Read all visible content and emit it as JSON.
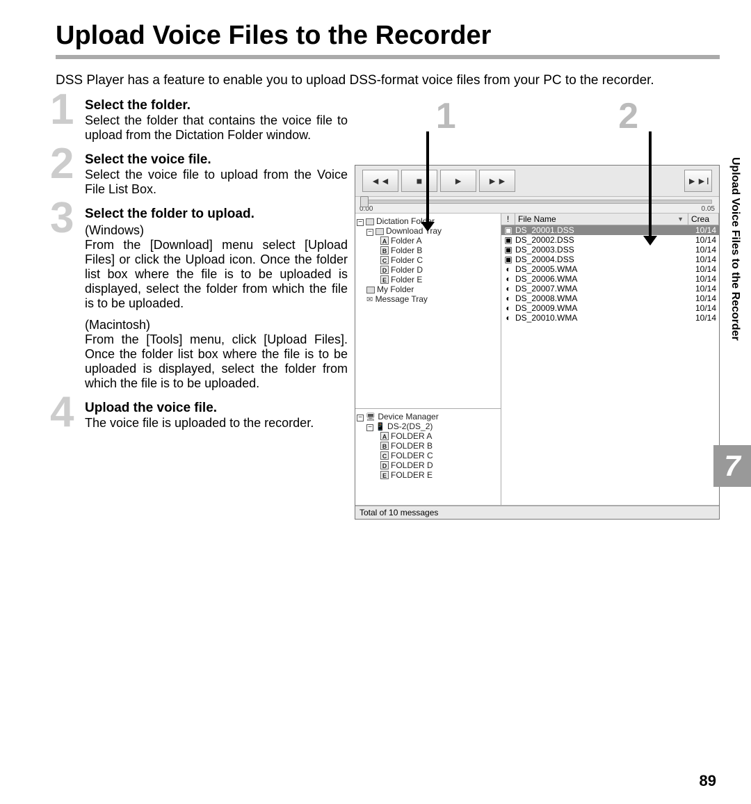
{
  "title": "Upload Voice Files to the Recorder",
  "intro": "DSS Player has a feature to enable you to upload DSS-format voice files from your PC to the recorder.",
  "steps": [
    {
      "num": "1",
      "title": "Select the folder.",
      "body": "Select the folder that contains the voice file to upload from the Dictation Folder window."
    },
    {
      "num": "2",
      "title": "Select the voice file.",
      "body": "Select the voice file to upload from the Voice File List Box."
    },
    {
      "num": "3",
      "title": "Select the folder to upload.",
      "platform1": "(Windows)",
      "body1": "From the [Download] menu select [Upload Files] or click the Upload icon. Once the folder list box where the file is to be uploaded is displayed, select the folder from which the file is to be uploaded.",
      "platform2": "(Macintosh)",
      "body2": "From the [Tools] menu, click [Upload Files]. Once the folder list box where the file is to be uploaded is displayed, select the folder from which the file is to be uploaded."
    },
    {
      "num": "4",
      "title": "Upload the voice file.",
      "body": "The voice file is uploaded to the recorder."
    }
  ],
  "callouts": {
    "c1": "1",
    "c2": "2"
  },
  "ruler": {
    "start": "0.00",
    "end": "0.05"
  },
  "file_header": {
    "exclaim": "!",
    "name": "File Name",
    "date": "Crea"
  },
  "tree": {
    "root": "Dictation Folder",
    "download": "Download Tray",
    "folders": [
      "Folder A",
      "Folder B",
      "Folder C",
      "Folder D",
      "Folder E"
    ],
    "myfolder": "My Folder",
    "msgtray": "Message Tray"
  },
  "device": {
    "root": "Device Manager",
    "dev": "DS-2(DS_2)",
    "folders": [
      "FOLDER A",
      "FOLDER B",
      "FOLDER C",
      "FOLDER D",
      "FOLDER E"
    ]
  },
  "files": [
    {
      "icon": "▣",
      "name": "DS_20001.DSS",
      "date": "10/14",
      "sel": true
    },
    {
      "icon": "▣",
      "name": "DS_20002.DSS",
      "date": "10/14"
    },
    {
      "icon": "▣",
      "name": "DS_20003.DSS",
      "date": "10/14"
    },
    {
      "icon": "▣",
      "name": "DS_20004.DSS",
      "date": "10/14"
    },
    {
      "icon": "◐",
      "name": "DS_20005.WMA",
      "date": "10/14"
    },
    {
      "icon": "◐",
      "name": "DS_20006.WMA",
      "date": "10/14"
    },
    {
      "icon": "◐",
      "name": "DS_20007.WMA",
      "date": "10/14"
    },
    {
      "icon": "◐",
      "name": "DS_20008.WMA",
      "date": "10/14"
    },
    {
      "icon": "◐",
      "name": "DS_20009.WMA",
      "date": "10/14"
    },
    {
      "icon": "◐",
      "name": "DS_20010.WMA",
      "date": "10/14"
    }
  ],
  "status": "Total of 10 messages",
  "side_tab": "Upload Voice Files to the Recorder",
  "chapter": "7",
  "page_num": "89"
}
